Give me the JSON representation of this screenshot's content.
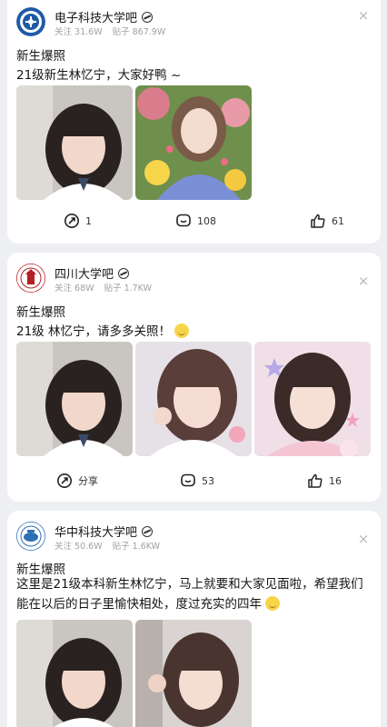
{
  "posts": [
    {
      "forum": "电子科技大学吧",
      "follow": "关注 31.6W",
      "posts": "贴子 867.9W",
      "close": "×",
      "title": "新生爆照",
      "text": "21级新生林忆宁，大家好鸭 ~",
      "share": "1",
      "comments": "108",
      "likes": "61",
      "avatar_color": "#1f5aa6"
    },
    {
      "forum": "四川大学吧",
      "follow": "关注 68W",
      "posts": "贴子 1.7KW",
      "close": "×",
      "title": "新生爆照",
      "text": "21级 林忆宁，请多多关照！",
      "share": "分享",
      "comments": "53",
      "likes": "16",
      "avatar_color": "#b52025"
    },
    {
      "forum": "华中科技大学吧",
      "follow": "关注 50.6W",
      "posts": "贴子 1.6KW",
      "close": "×",
      "title": "新生爆照",
      "text": "这里是21级本科新生林忆宁，马上就要和大家见面啦，希望我们能在以后的日子里愉快相处，度过充实的四年",
      "avatar_color": "#2d6fb5"
    }
  ]
}
